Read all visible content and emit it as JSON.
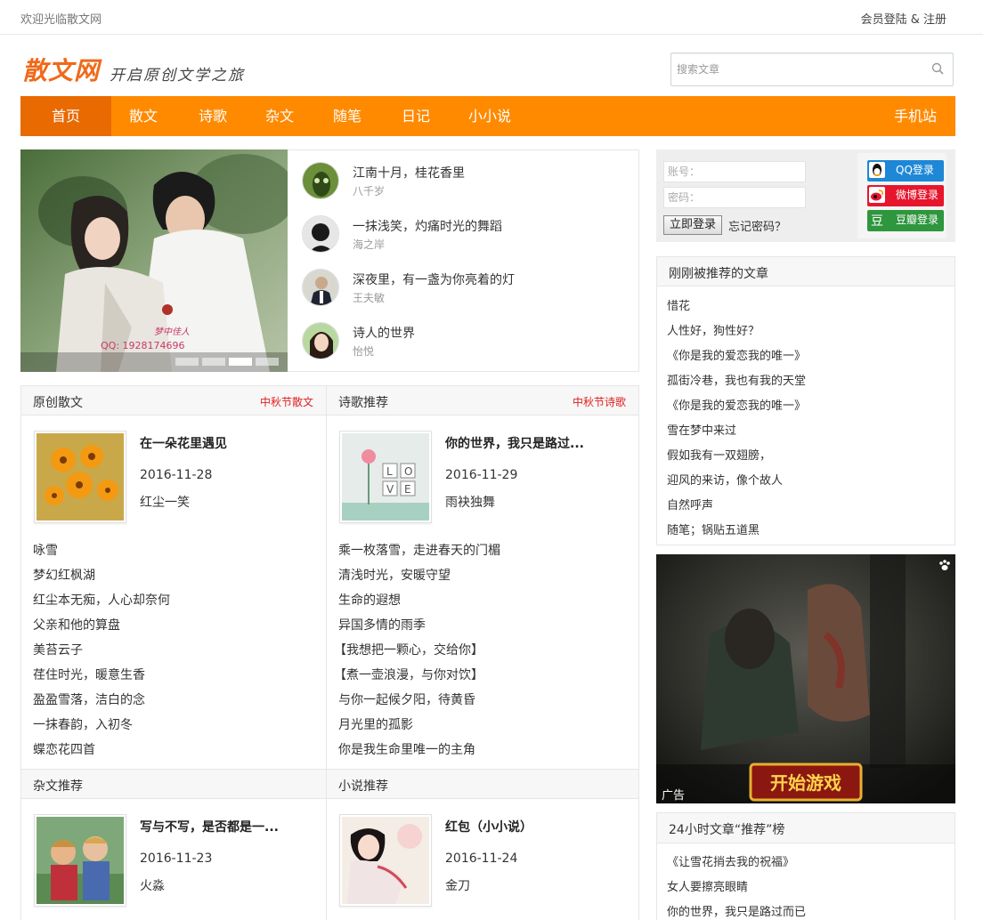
{
  "topbar": {
    "welcome": "欢迎光临散文网",
    "login_register": "会员登陆 & 注册"
  },
  "header": {
    "logo": "散文网",
    "slogan": "开启原创文学之旅",
    "search_placeholder": "搜索文章"
  },
  "nav": {
    "items": [
      "首页",
      "散文",
      "诗歌",
      "杂文",
      "随笔",
      "日记",
      "小小说"
    ],
    "active": "首页",
    "mobile": "手机站"
  },
  "slider": {
    "caption": "梦中佳人 QQ: 1928174696",
    "slides": 4,
    "active_slide": 3
  },
  "featured": [
    {
      "title": "江南十月，桂花香里",
      "author": "八千岁"
    },
    {
      "title": "一抹浅笑，灼痛时光的舞蹈",
      "author": "海之岸"
    },
    {
      "title": "深夜里，有一盏为你亮着的灯",
      "author": "王夫敏"
    },
    {
      "title": "诗人的世界",
      "author": "怡悦"
    }
  ],
  "sections": {
    "prose": {
      "title": "原创散文",
      "more": "中秋节散文",
      "card": {
        "title": "在一朵花里遇见",
        "date": "2016-11-28",
        "author": "红尘一笑"
      },
      "links": [
        "咏雪",
        "梦幻红枫湖",
        "红尘本无痴，人心却奈何",
        "父亲和他的算盘",
        "美苔云子",
        "荏住时光，暖意生香",
        "盈盈雪落，洁白的念",
        "一抹春韵，入初冬",
        "蝶恋花四首"
      ]
    },
    "poetry": {
      "title": "诗歌推荐",
      "more": "中秋节诗歌",
      "card": {
        "title": "你的世界，我只是路过...",
        "date": "2016-11-29",
        "author": "雨袂独舞"
      },
      "links": [
        "乘一枚落雪，走进春天的门楣",
        "清浅时光，安暖守望",
        "生命的遐想",
        "异国多情的雨季",
        "【我想把一颗心，交给你】",
        "【煮一壶浪漫，与你对饮】",
        "与你一起候夕阳，待黄昏",
        "月光里的孤影",
        "你是我生命里唯一的主角"
      ]
    },
    "essay": {
      "title": "杂文推荐",
      "card": {
        "title": "写与不写，是否都是一...",
        "date": "2016-11-23",
        "author": "火淼"
      }
    },
    "novel": {
      "title": "小说推荐",
      "card": {
        "title": "红包（小小说）",
        "date": "2016-11-24",
        "author": "金刀"
      }
    }
  },
  "login": {
    "account_placeholder": "账号：",
    "password_placeholder": "密码：",
    "submit": "立即登录",
    "forgot": "忘记密码？",
    "social": [
      {
        "label": "QQ登录",
        "color": "#1e88d6"
      },
      {
        "label": "微博登录",
        "color": "#e6162d"
      },
      {
        "label": "豆瓣登录",
        "color": "#2e963d"
      }
    ]
  },
  "recent": {
    "title": "刚刚被推荐的文章",
    "items": [
      "惜花",
      "人性好，狗性好？",
      "《你是我的爱恋我的唯一》",
      "孤街冷巷，我也有我的天堂",
      "《你是我的爱恋我的唯一》",
      "雪在梦中来过",
      "假如我有一双翅膀，",
      "迎风的来访，像个故人",
      "自然呼声",
      "随笔；锅贴五道黑"
    ]
  },
  "ad": {
    "label": "广告",
    "button": "开始游戏"
  },
  "top24": {
    "title": "24小时文章“推荐”榜",
    "items": [
      "《让雪花捎去我的祝福》",
      "女人要擦亮眼睛",
      "你的世界，我只是路过而已"
    ]
  },
  "colors": {
    "accent": "#ff8a00",
    "accent_dark": "#e86a00",
    "brand": "#ef6a1a",
    "link_red": "#e02020"
  }
}
